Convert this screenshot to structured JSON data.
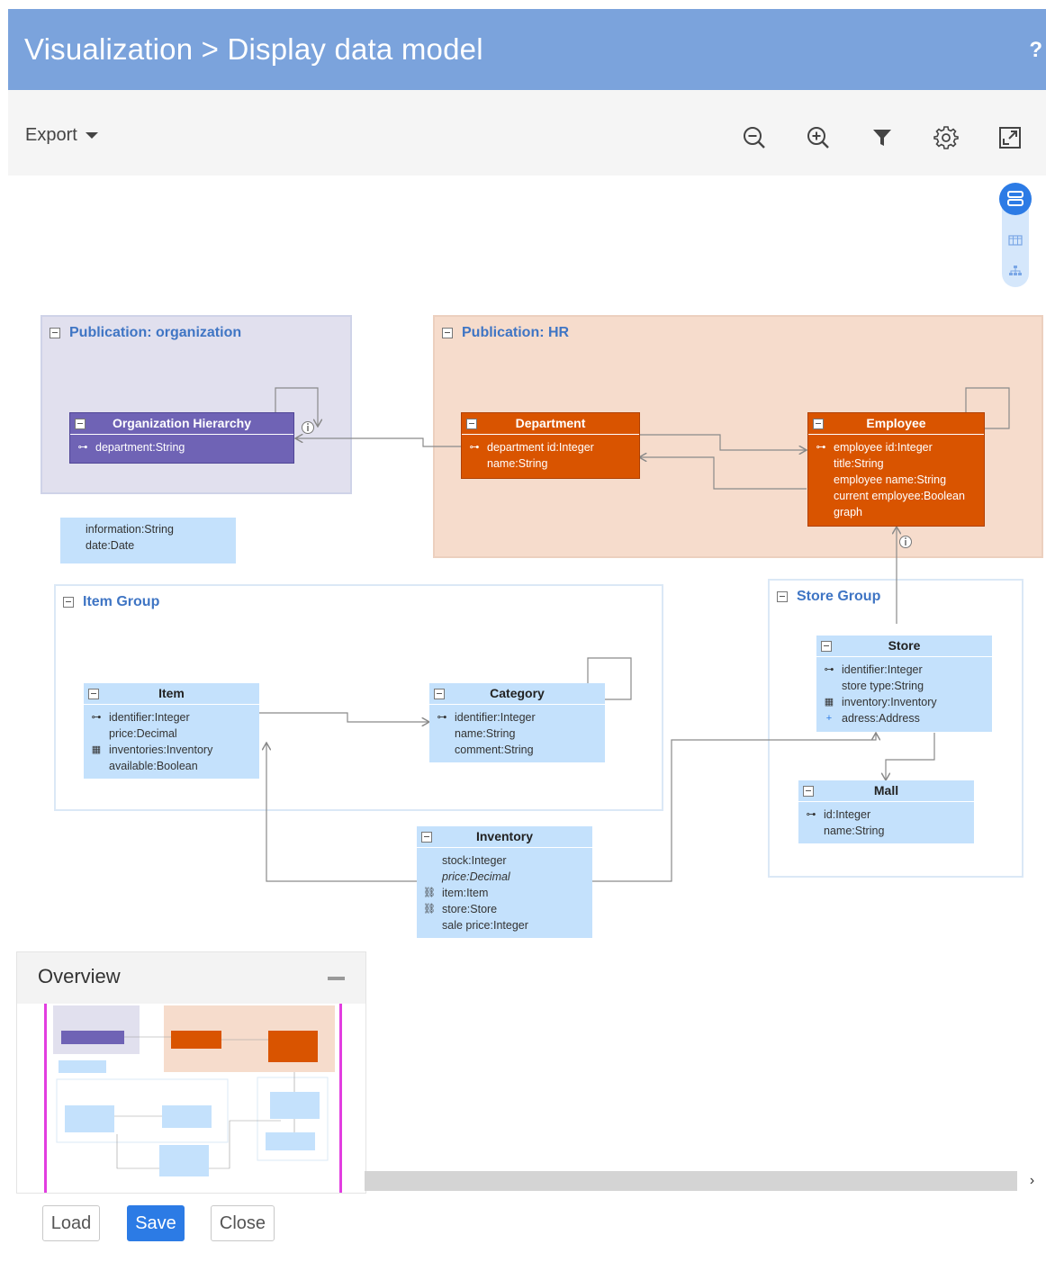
{
  "window": {
    "title": "Visualization > Display data model",
    "help": "?"
  },
  "toolbar": {
    "export_label": "Export",
    "icons": [
      "zoom-out-icon",
      "zoom-in-icon",
      "filter-icon",
      "settings-icon",
      "fit-screen-icon"
    ]
  },
  "view_switch": {
    "icons": [
      "data-model-view-icon",
      "table-view-icon",
      "hierarchy-view-icon"
    ]
  },
  "publications": [
    {
      "title": "Publication: organization",
      "color": "#e1e0ee"
    },
    {
      "title": "Publication: HR",
      "color": "#f6dccc"
    }
  ],
  "groups": [
    {
      "title": "Item Group"
    },
    {
      "title": "Store Group"
    }
  ],
  "entities": {
    "org_hierarchy": {
      "name": "Organization Hierarchy",
      "fields": [
        "department:String"
      ]
    },
    "department": {
      "name": "Department",
      "fields": [
        "department id:Integer",
        "name:String"
      ]
    },
    "employee": {
      "name": "Employee",
      "fields": [
        "employee id:Integer",
        "title:String",
        "employee name:String",
        "current employee:Boolean",
        "graph"
      ]
    },
    "item": {
      "name": "Item",
      "fields": [
        "identifier:Integer",
        "price:Decimal",
        "inventories:Inventory",
        "available:Boolean"
      ]
    },
    "category": {
      "name": "Category",
      "fields": [
        "identifier:Integer",
        "name:String",
        "comment:String"
      ]
    },
    "store": {
      "name": "Store",
      "fields": [
        "identifier:Integer",
        "store type:String",
        "inventory:Inventory",
        "adress:Address"
      ]
    },
    "mall": {
      "name": "Mall",
      "fields": [
        "id:Integer",
        "name:String"
      ]
    },
    "inventory": {
      "name": "Inventory",
      "fields": [
        "stock:Integer",
        "price:Decimal",
        "item:Item",
        "store:Store",
        "sale price:Integer"
      ]
    }
  },
  "note": {
    "lines": [
      "information:String",
      "date:Date"
    ]
  },
  "colors": {
    "header": "#7ba3dc",
    "entity_blue": "#c4e1fc",
    "entity_orange": "#d95400",
    "entity_purple": "#6f63b5",
    "group_title": "#3f75c4",
    "primary_button": "#2c7be5",
    "overview_frame": "#e23ee0"
  },
  "overview": {
    "title": "Overview"
  },
  "footer": {
    "load": "Load",
    "save": "Save",
    "close": "Close"
  }
}
